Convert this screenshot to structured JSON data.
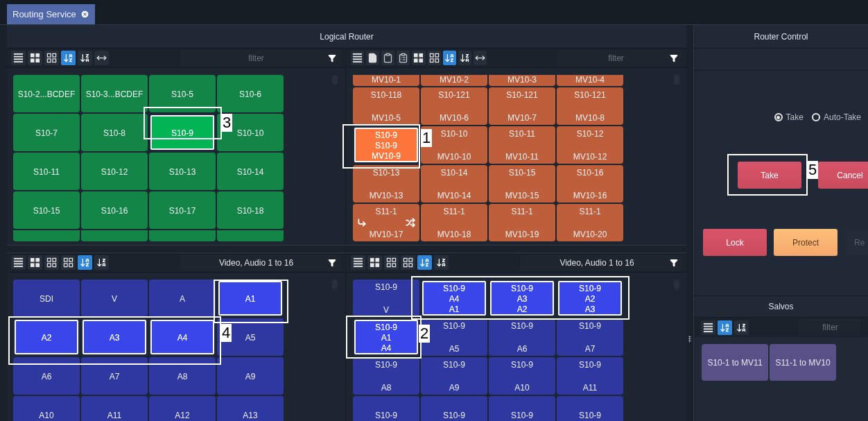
{
  "tabs": [
    {
      "label": "Routing Service",
      "selected": true
    }
  ],
  "logical_router": {
    "title": "Logical Router",
    "panels": [
      {
        "color": "#138547",
        "tools": [
          {
            "kind": "list",
            "selected": false
          },
          {
            "kind": "tiles",
            "selected": false
          },
          {
            "kind": "grid",
            "selected": false
          },
          {
            "kind": "sort-az",
            "selected": true
          },
          {
            "kind": "sort-za",
            "selected": false
          },
          {
            "kind": "fit",
            "selected": false
          }
        ],
        "filter": {
          "placeholder": "filter"
        },
        "tiles": [
          {
            "kind": "full",
            "lines": [
              "S10-2...BCDEF"
            ],
            "selected": false
          },
          {
            "kind": "full",
            "lines": [
              "S10-3...BCDEF"
            ],
            "selected": false
          },
          {
            "kind": "full",
            "lines": [
              "S10-5"
            ],
            "selected": false
          },
          {
            "kind": "full",
            "lines": [
              "S10-6"
            ],
            "selected": false
          },
          {
            "kind": "full",
            "lines": [
              "S10-7"
            ],
            "selected": false
          },
          {
            "kind": "full",
            "lines": [
              "S10-8"
            ],
            "selected": false
          },
          {
            "kind": "full",
            "lines": [
              "S10-9"
            ],
            "selected": true
          },
          {
            "kind": "full",
            "lines": [
              "S10-10"
            ],
            "selected": false
          },
          {
            "kind": "full",
            "lines": [
              "S10-11"
            ],
            "selected": false
          },
          {
            "kind": "full",
            "lines": [
              "S10-12"
            ],
            "selected": false
          },
          {
            "kind": "full",
            "lines": [
              "S10-13"
            ],
            "selected": false
          },
          {
            "kind": "full",
            "lines": [
              "S10-14"
            ],
            "selected": false
          },
          {
            "kind": "full",
            "lines": [
              "S10-15"
            ],
            "selected": false
          },
          {
            "kind": "full",
            "lines": [
              "S10-16"
            ],
            "selected": false
          },
          {
            "kind": "full",
            "lines": [
              "S10-17"
            ],
            "selected": false
          },
          {
            "kind": "full",
            "lines": [
              "S10-18"
            ],
            "selected": false
          },
          {
            "kind": "clipped",
            "selected": false
          },
          {
            "kind": "clipped",
            "selected": false
          },
          {
            "kind": "clipped",
            "selected": false
          },
          {
            "kind": "clipped",
            "selected": false
          }
        ]
      },
      {
        "color": "#bf5e3a",
        "tools": [
          {
            "kind": "list",
            "selected": false
          },
          {
            "kind": "document",
            "selected": false
          },
          {
            "kind": "clipboard",
            "selected": false
          },
          {
            "kind": "paste",
            "selected": false
          },
          {
            "kind": "tiles",
            "selected": false
          },
          {
            "kind": "grid",
            "selected": false
          },
          {
            "kind": "sort-az",
            "selected": true
          },
          {
            "kind": "sort-za",
            "selected": false
          },
          {
            "kind": "fit",
            "selected": false
          }
        ],
        "filter": {
          "placeholder": "filter"
        },
        "tiles": [
          {
            "kind": "clipped",
            "lines": [
              "MV10-1"
            ],
            "selected": false
          },
          {
            "kind": "clipped",
            "lines": [
              "MV10-2"
            ],
            "selected": false
          },
          {
            "kind": "clipped",
            "lines": [
              "MV10-3"
            ],
            "selected": false
          },
          {
            "kind": "clipped",
            "lines": [
              "MV10-4"
            ],
            "selected": false
          },
          {
            "kind": "full",
            "lines": [
              "S10-118",
              "MV10-5"
            ],
            "selected": false
          },
          {
            "kind": "full",
            "lines": [
              "S10-121",
              "MV10-6"
            ],
            "selected": false
          },
          {
            "kind": "full",
            "lines": [
              "S10-121",
              "MV10-7"
            ],
            "selected": false
          },
          {
            "kind": "full",
            "lines": [
              "S10-121",
              "MV10-8"
            ],
            "selected": false
          },
          {
            "kind": "full",
            "lines": [
              "S10-9",
              "S10-9",
              "MV10-9"
            ],
            "selected": true
          },
          {
            "kind": "full",
            "lines": [
              "S10-10",
              "MV10-10"
            ],
            "selected": false
          },
          {
            "kind": "full",
            "lines": [
              "S10-11",
              "MV10-11"
            ],
            "selected": false
          },
          {
            "kind": "full",
            "lines": [
              "S10-12",
              "MV10-12"
            ],
            "selected": false
          },
          {
            "kind": "full",
            "lines": [
              "S10-13",
              "MV10-13"
            ],
            "selected": false
          },
          {
            "kind": "full",
            "lines": [
              "S10-14",
              "MV10-14"
            ],
            "selected": false
          },
          {
            "kind": "full",
            "lines": [
              "S10-15",
              "MV10-15"
            ],
            "selected": false
          },
          {
            "kind": "full",
            "lines": [
              "S10-16",
              "MV10-16"
            ],
            "selected": false
          },
          {
            "kind": "full",
            "lines": [
              "S11-1",
              "MV10-17"
            ],
            "selected": false,
            "route_icons": true
          },
          {
            "kind": "full",
            "lines": [
              "S11-1",
              "MV10-18"
            ],
            "selected": false
          },
          {
            "kind": "full",
            "lines": [
              "S11-1",
              "MV10-19"
            ],
            "selected": false
          },
          {
            "kind": "full",
            "lines": [
              "S11-1",
              "MV10-20"
            ],
            "selected": false
          }
        ]
      },
      {
        "color": "#2f37a0",
        "tools": [
          {
            "kind": "list",
            "selected": false
          },
          {
            "kind": "tiles",
            "selected": false
          },
          {
            "kind": "grid",
            "selected": false
          },
          {
            "kind": "grid-alt",
            "selected": false
          },
          {
            "kind": "sort-az",
            "selected": true
          },
          {
            "kind": "sort-za",
            "selected": false
          }
        ],
        "filter": {
          "value": "Video, Audio 1 to 16"
        },
        "tiles": [
          {
            "kind": "full",
            "lines": [
              "SDI"
            ],
            "selected": false
          },
          {
            "kind": "full",
            "lines": [
              "V"
            ],
            "selected": false
          },
          {
            "kind": "full",
            "lines": [
              "A"
            ],
            "selected": false
          },
          {
            "kind": "full",
            "lines": [
              "A1"
            ],
            "selected": true
          },
          {
            "kind": "full",
            "lines": [
              "A2"
            ],
            "selected": true
          },
          {
            "kind": "full",
            "lines": [
              "A3"
            ],
            "selected": true
          },
          {
            "kind": "full",
            "lines": [
              "A4"
            ],
            "selected": true
          },
          {
            "kind": "full",
            "lines": [
              "A5"
            ],
            "selected": false
          },
          {
            "kind": "full",
            "lines": [
              "A6"
            ],
            "selected": false
          },
          {
            "kind": "full",
            "lines": [
              "A7"
            ],
            "selected": false
          },
          {
            "kind": "full",
            "lines": [
              "A8"
            ],
            "selected": false
          },
          {
            "kind": "full",
            "lines": [
              "A9"
            ],
            "selected": false
          },
          {
            "kind": "full",
            "lines": [
              "A10"
            ],
            "selected": false
          },
          {
            "kind": "full",
            "lines": [
              "A11"
            ],
            "selected": false
          },
          {
            "kind": "full",
            "lines": [
              "A12"
            ],
            "selected": false
          },
          {
            "kind": "full",
            "lines": [
              "A13"
            ],
            "selected": false
          }
        ]
      },
      {
        "color": "#2f37a0",
        "tools": [
          {
            "kind": "list",
            "selected": false
          },
          {
            "kind": "tiles",
            "selected": false
          },
          {
            "kind": "grid",
            "selected": false
          },
          {
            "kind": "grid-alt",
            "selected": false
          },
          {
            "kind": "sort-az",
            "selected": true
          },
          {
            "kind": "sort-za",
            "selected": false
          }
        ],
        "filter": {
          "value": "Video, Audio 1 to 16"
        },
        "tiles": [
          {
            "kind": "full",
            "lines": [
              "S10-9",
              "V"
            ],
            "selected": false
          },
          {
            "kind": "full",
            "lines": [
              "S10-9",
              "A4",
              "A1"
            ],
            "selected": true
          },
          {
            "kind": "full",
            "lines": [
              "S10-9",
              "A3",
              "A2"
            ],
            "selected": true
          },
          {
            "kind": "full",
            "lines": [
              "S10-9",
              "A2",
              "A3"
            ],
            "selected": true
          },
          {
            "kind": "full",
            "lines": [
              "S10-9",
              "A1",
              "A4"
            ],
            "selected": true
          },
          {
            "kind": "full",
            "lines": [
              "S10-9",
              "A5"
            ],
            "selected": false
          },
          {
            "kind": "full",
            "lines": [
              "S10-9",
              "A6"
            ],
            "selected": false
          },
          {
            "kind": "full",
            "lines": [
              "S10-9",
              "A7"
            ],
            "selected": false
          },
          {
            "kind": "full",
            "lines": [
              "S10-9",
              "A8"
            ],
            "selected": false
          },
          {
            "kind": "full",
            "lines": [
              "S10-9",
              "A9"
            ],
            "selected": false
          },
          {
            "kind": "full",
            "lines": [
              "S10-9",
              "A10"
            ],
            "selected": false
          },
          {
            "kind": "full",
            "lines": [
              "S10-9",
              "A11"
            ],
            "selected": false
          },
          {
            "kind": "full",
            "lines": [
              "S10-9"
            ],
            "selected": false
          },
          {
            "kind": "full",
            "lines": [
              "S10-9"
            ],
            "selected": false
          },
          {
            "kind": "full",
            "lines": [
              "S10-9"
            ],
            "selected": false
          },
          {
            "kind": "full",
            "lines": [
              "S10-9"
            ],
            "selected": false
          }
        ]
      }
    ]
  },
  "router_control": {
    "title": "Router Control",
    "modes": [
      {
        "label": "Take",
        "selected": true
      },
      {
        "label": "Auto-Take",
        "selected": false
      }
    ],
    "actions": [
      {
        "label": "Take",
        "kind": "danger"
      },
      {
        "label": "Cancel",
        "kind": "danger"
      }
    ],
    "locks": [
      {
        "label": "Lock",
        "kind": "danger"
      },
      {
        "label": "Protect",
        "kind": "warning"
      },
      {
        "label": "Re",
        "kind": "disabled"
      }
    ]
  },
  "salvos": {
    "title": "Salvos",
    "tools": [
      {
        "kind": "list",
        "selected": false
      },
      {
        "kind": "sort-az",
        "selected": true
      },
      {
        "kind": "sort-za",
        "selected": false
      }
    ],
    "filter": {
      "placeholder": "filter"
    },
    "items": [
      "S10-1 to MV11",
      "S11-1 to MV10"
    ]
  },
  "callouts": [
    {
      "label": "1"
    },
    {
      "label": "2"
    },
    {
      "label": "3"
    },
    {
      "label": "4"
    },
    {
      "label": "5"
    }
  ]
}
